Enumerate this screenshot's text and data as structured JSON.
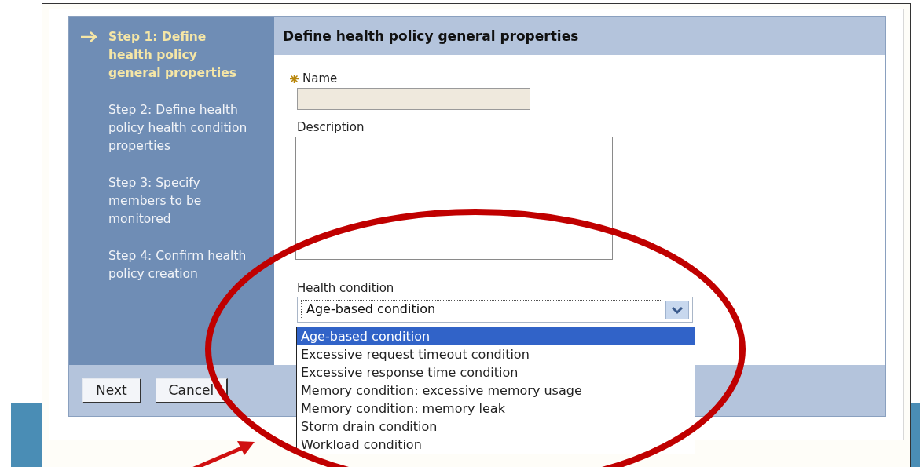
{
  "steps": [
    {
      "label": "Step 1: Define health policy general properties",
      "selected": true
    },
    {
      "label": "Step 2: Define health policy health condition properties",
      "selected": false
    },
    {
      "label": "Step 3: Specify members to be monitored",
      "selected": false
    },
    {
      "label": "Step 4: Confirm health policy creation",
      "selected": false
    }
  ],
  "header": "Define health policy general properties",
  "name_field": {
    "label": "Name",
    "required": true
  },
  "description_field": {
    "label": "Description"
  },
  "health_condition": {
    "label": "Health condition",
    "value": "Age-based condition",
    "expanded": true,
    "options": [
      {
        "label": "Age-based condition",
        "selected": true
      },
      {
        "label": "Excessive request timeout condition",
        "selected": false
      },
      {
        "label": "Excessive response time condition",
        "selected": false
      },
      {
        "label": "Memory condition: excessive memory usage",
        "selected": false
      },
      {
        "label": "Memory condition: memory leak",
        "selected": false
      },
      {
        "label": "Storm drain condition",
        "selected": false
      },
      {
        "label": "Workload condition",
        "selected": false
      }
    ]
  },
  "buttons": [
    "Next",
    "Cancel"
  ]
}
